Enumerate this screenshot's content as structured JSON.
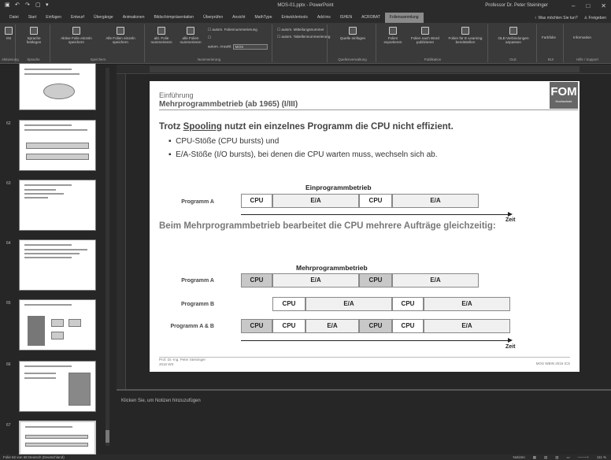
{
  "window": {
    "doc_title": "MOS-01.pptx - PowerPoint",
    "user": "Professor Dr. Peter Steininger",
    "quick_access": [
      "save-icon",
      "undo-icon",
      "redo-icon",
      "start-icon",
      "customize-icon"
    ]
  },
  "tabs": [
    "Datei",
    "Start",
    "Einfügen",
    "Entwurf",
    "Übergänge",
    "Animationen",
    "Bildschirmpräsentation",
    "Überprüfen",
    "Ansicht",
    "MathType",
    "Entwicklertools",
    "Add-ins",
    "ISHEN",
    "ACROBAT",
    "Foliensammlung"
  ],
  "tabs_active": "Foliensammlung",
  "tell_me": "Was möchten Sie tun?",
  "share": "Freigeben",
  "ribbon": {
    "groups": [
      {
        "label": "Aktivierung"
      },
      {
        "label": "Sprache"
      },
      {
        "label": "Speichern"
      },
      {
        "label": "Nummerierung"
      },
      {
        "label": "Quellenverwaltung"
      },
      {
        "label": "Publikation"
      },
      {
        "label": "OLE"
      },
      {
        "label": "BUI"
      },
      {
        "label": "Hilfe / Support"
      }
    ],
    "buttons": {
      "ini": "INI",
      "sprache": "Sprache festlegen",
      "aktive_folie": "Aktive Folie einzeln speichern",
      "alle_folien": "Alle Folien einzeln speichern",
      "akt_folie_num": "akt. Folie nummerieren",
      "alle_folien_num": "alle Folien nummerieren",
      "auto_folien": "autom. Foliennummerierung",
      "auto_anzahl": "autom. Anzahl:",
      "anzahl_val": "MOS",
      "auto_mitteilung": "autom. Mitteilungsnummer",
      "auto_tabelle": "autom. Tabellennummerierung",
      "quelle": "Quelle einfügen",
      "folien_export": "Folien exportieren",
      "folien_word": "Folien nach Word publizieren",
      "folien_elearning": "Folien für E-Learning bereitstellen",
      "ole": "OLE-Verbindungen anpassen",
      "farbfolie": "Farbfolie",
      "information": "Information"
    }
  },
  "thumbnails": [
    {
      "num": "",
      "selected": false
    },
    {
      "num": "62",
      "selected": false
    },
    {
      "num": "63",
      "selected": false
    },
    {
      "num": "64",
      "selected": false
    },
    {
      "num": "65",
      "selected": false
    },
    {
      "num": "66",
      "selected": false
    },
    {
      "num": "67",
      "selected": false
    }
  ],
  "slide": {
    "subtitle": "Einführung",
    "title": "Mehrprogrammbetrieb (ab 1965) (I/III)",
    "logo_big": "FOM",
    "logo_small": "Hochschule",
    "line1_pre": "Trotz ",
    "line1_u": "Spooling",
    "line1_post": " nutzt ein einzelnes Programm die CPU nicht effizient.",
    "bullet1": "CPU-Stöße (CPU bursts) und",
    "bullet2": "E/A-Stöße (I/O bursts), bei denen die CPU warten muss, wechseln sich ab.",
    "diag1_title": "Einprogrammbetrieb",
    "diag1_row": "Programm A",
    "line2": "Beim Mehrprogrammbetrieb bearbeitet die CPU mehrere Aufträge gleichzeitig:",
    "diag2_title": "Mehrprogrammbetrieb",
    "diag2_rows": [
      "Programm A",
      "Programm B",
      "Programm A & B"
    ],
    "cpu": "CPU",
    "ea": "E/A",
    "zeit": "Zeit",
    "footer_left_1": "Prof. Dr.-Ing. Peter Steininger",
    "footer_left_2": "2016 WS",
    "footer_right": "MOS WBIN 2016 ICS"
  },
  "notes_placeholder": "Klicken Sie, um Notizen hinzuzufügen",
  "status": {
    "left": "Folie 62 von 68    Deutsch (Deutschland)",
    "notes": "Notizen",
    "zoom": "111 %"
  }
}
